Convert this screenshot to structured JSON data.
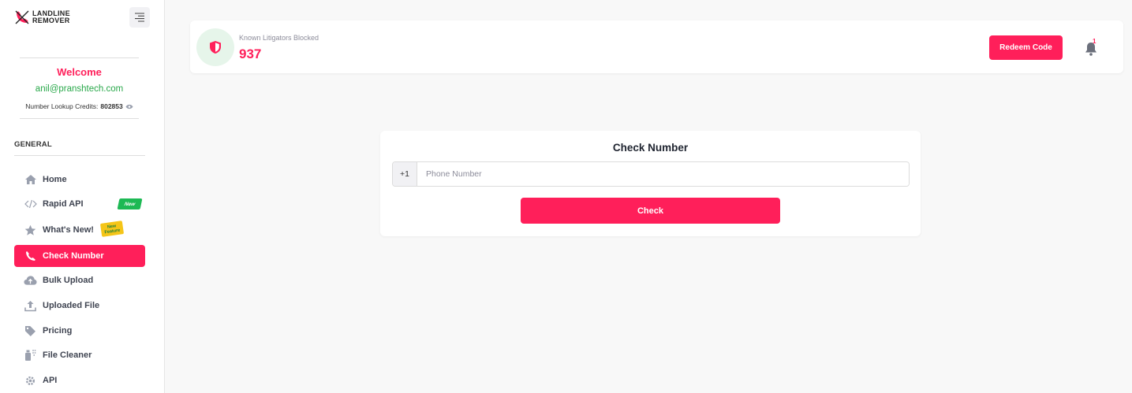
{
  "brand": {
    "line1": "LANDLINE",
    "line2": "REMOVER",
    "accent_color": "#ff1f5a"
  },
  "sidebar": {
    "welcome_title": "Welcome",
    "user_email": "anil@pranshtech.com",
    "credits_label": "Number Lookup Credits:",
    "credits_value": "802853",
    "section_label": "GENERAL",
    "items": [
      {
        "label": "Home",
        "icon": "home-icon"
      },
      {
        "label": "Rapid API",
        "icon": "code-icon",
        "badge": "New"
      },
      {
        "label": "What's New!",
        "icon": "star-icon",
        "badge": "New Feature"
      },
      {
        "label": "Check Number",
        "icon": "phone-icon",
        "active": true
      },
      {
        "label": "Bulk Upload",
        "icon": "cloud-upload-icon"
      },
      {
        "label": "Uploaded File",
        "icon": "upload-icon"
      },
      {
        "label": "Pricing",
        "icon": "tag-icon"
      },
      {
        "label": "File Cleaner",
        "icon": "spray-bottle-icon"
      },
      {
        "label": "API",
        "icon": "gear-icon"
      }
    ]
  },
  "header": {
    "stat_label": "Known Litigators Blocked",
    "stat_value": "937",
    "redeem_label": "Redeem Code",
    "notification_count": "1"
  },
  "check": {
    "title": "Check Number",
    "country_code": "+1",
    "phone_placeholder": "Phone Number",
    "phone_value": "",
    "button_label": "Check"
  }
}
